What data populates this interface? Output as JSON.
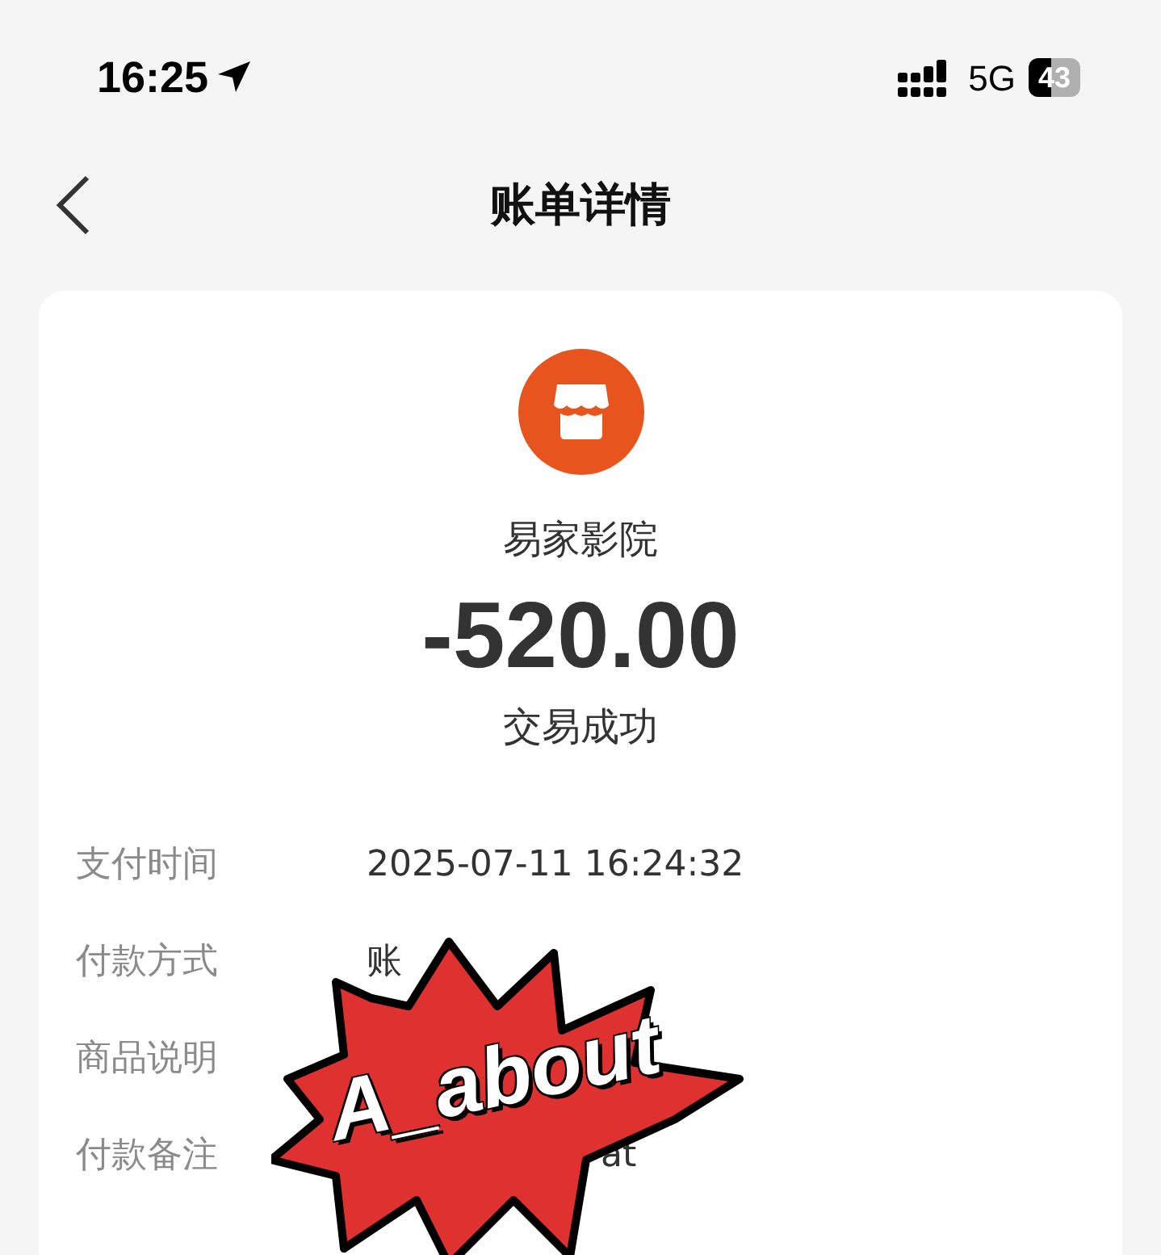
{
  "status_bar": {
    "time": "16:25",
    "network": "5G",
    "battery": "43"
  },
  "nav": {
    "title": "账单详情"
  },
  "bill": {
    "merchant": "易家影院",
    "amount": "-520.00",
    "status": "交易成功",
    "rows": [
      {
        "label": "支付时间",
        "value": "2025-07-11 16:24:32"
      },
      {
        "label": "付款方式",
        "value": "账"
      },
      {
        "label": "商品说明"
      },
      {
        "label": "付款备注",
        "value": "at"
      }
    ]
  },
  "sticker": {
    "text": "A_about"
  }
}
